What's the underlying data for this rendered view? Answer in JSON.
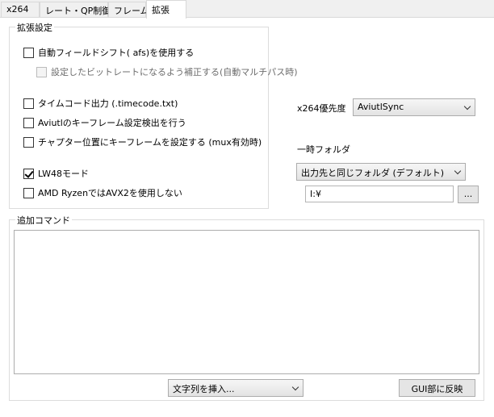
{
  "tabs": [
    {
      "label": "x264"
    },
    {
      "label": "レート・QP制御"
    },
    {
      "label": "フレーム"
    },
    {
      "label": "拡張"
    }
  ],
  "ext_settings": {
    "title": "拡張設定",
    "afs": {
      "label": "自動フィールドシフト( afs)を使用する",
      "checked": false
    },
    "afs_bitrate": {
      "label": "設定したビットレートになるよう補正する(自動マルチパス時)",
      "checked": false,
      "enabled": false
    },
    "timecode": {
      "label": "タイムコード出力 (.timecode.txt)",
      "checked": false
    },
    "keyframe_detect": {
      "label": "Aviutlのキーフレーム設定検出を行う",
      "checked": false
    },
    "chapter_keyframe": {
      "label": "チャプター位置にキーフレームを設定する (mux有効時)",
      "checked": false
    },
    "lw48": {
      "label": "LW48モード",
      "checked": true
    },
    "ryzen_avx2": {
      "label": "AMD RyzenではAVX2を使用しない",
      "checked": false
    }
  },
  "x264_priority": {
    "label": "x264優先度",
    "value": "AviutlSync"
  },
  "temp_folder": {
    "label": "一時フォルダ",
    "mode": "出力先と同じフォルダ (デフォルト)",
    "path": "I:¥",
    "browse_label": "..."
  },
  "additional_command": {
    "title": "追加コマンド",
    "text": "",
    "insert_label": "文字列を挿入...",
    "apply_label": "GUI部に反映"
  }
}
